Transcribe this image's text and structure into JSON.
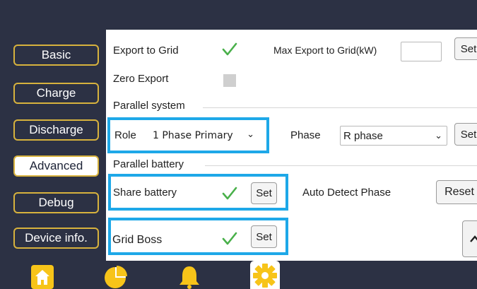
{
  "sidebar": {
    "items": [
      {
        "label": "Basic"
      },
      {
        "label": "Charge"
      },
      {
        "label": "Discharge"
      },
      {
        "label": "Advanced"
      },
      {
        "label": "Debug"
      },
      {
        "label": "Device info."
      }
    ]
  },
  "advanced": {
    "export_to_grid_label": "Export to Grid",
    "export_to_grid_checked": true,
    "max_export_label": "Max Export to Grid(kW)",
    "max_export_value": "",
    "max_export_set": "Set",
    "zero_export_label": "Zero Export",
    "zero_export_checked": false,
    "parallel_system_title": "Parallel system",
    "role_label": "Role",
    "role_value": "1 Phase Primary",
    "phase_label": "Phase",
    "phase_value": "R phase",
    "phase_set": "Set",
    "parallel_battery_title": "Parallel battery",
    "share_battery_label": "Share battery",
    "share_battery_checked": true,
    "share_battery_set": "Set",
    "auto_detect_label": "Auto Detect Phase",
    "reset_label": "Reset",
    "grid_boss_label": "Grid Boss",
    "grid_boss_checked": true,
    "grid_boss_set": "Set",
    "scroll_up_icon": "chevron-up-icon"
  },
  "bottom_nav": [
    "home-icon",
    "pie-chart-icon",
    "bell-icon",
    "gear-icon"
  ],
  "colors": {
    "frame": "#2c3144",
    "accent_gold": "#d7b23d",
    "highlight_blue": "#1ea8e8",
    "check_green": "#49b04a",
    "icon_yellow": "#f7c419"
  }
}
